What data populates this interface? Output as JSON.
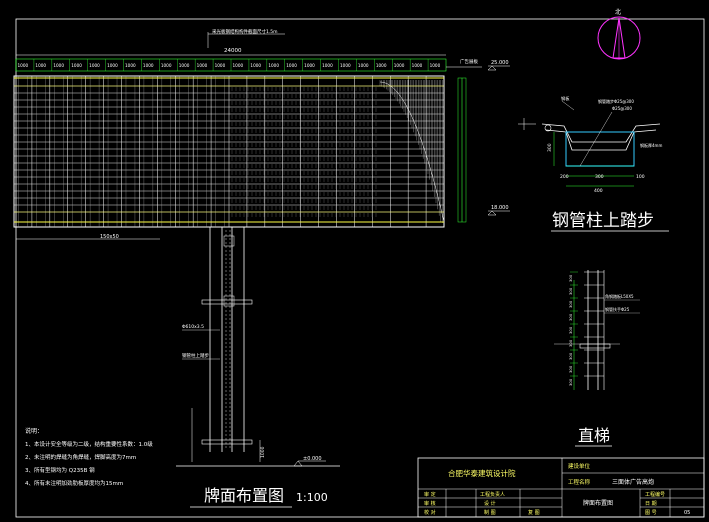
{
  "billboard": {
    "top_dim_note": "采光板钢结构构件截面尺寸1.5m",
    "overall_width": "24000",
    "segment_dim": "1000",
    "segment_count": 24,
    "label_top_right": "广告展板",
    "elev_top": "25.000",
    "elev_bottom": "18.000",
    "beam_label": "150x50",
    "panel_height_dim": "7000"
  },
  "column": {
    "label_pipe": "Φ610x3.5",
    "label_ladder": "钢管柱上踏步",
    "base_dim": "1000",
    "ground_elev": "±0.000"
  },
  "north_arrow": {
    "label": "北"
  },
  "detail_step": {
    "title": "钢管柱上踏步",
    "label_a": "钢板",
    "label_b": "钢管踏步Φ25@300",
    "label_c": "Φ25@300",
    "label_d": "钢板厚4mm",
    "dim_left": "200",
    "dim_mid": "300",
    "dim_right": "100",
    "dim_total": "400",
    "dim_height": "300"
  },
  "detail_ladder": {
    "title": "直梯",
    "label_a": "角钢踏板L50X5",
    "label_b": "钢管扶手Φ25",
    "dims": [
      "300",
      "300",
      "300",
      "300",
      "300",
      "300",
      "300",
      "300",
      "300"
    ]
  },
  "notes": {
    "heading": "说明：",
    "items": [
      "1、本设计安全等级为二级，结构重要性系数：1.0级",
      "2、未注明的焊缝为角焊缝，焊脚高度为7mm",
      "3、所有型钢均为 Q235B 钢",
      "4、所有未注明加劲肋板厚度均为15mm"
    ]
  },
  "main_title": {
    "text": "牌面布置图",
    "scale": "1:100"
  },
  "title_block": {
    "company": "合肥华泰建筑设计院",
    "row1_label": "建设单位",
    "row2_label": "工程名称",
    "row2_value": "三面体广告高炮",
    "drawing_name": "牌面布置图",
    "approve": "审 定",
    "review": "审 核",
    "check": "校 对",
    "leader": "工程负责人",
    "design": "设 计",
    "draw": "制 图",
    "proof": "复 图",
    "project_no": "工程编号",
    "date": "日 期",
    "sheet": "图 号",
    "sheet_value": "05"
  }
}
